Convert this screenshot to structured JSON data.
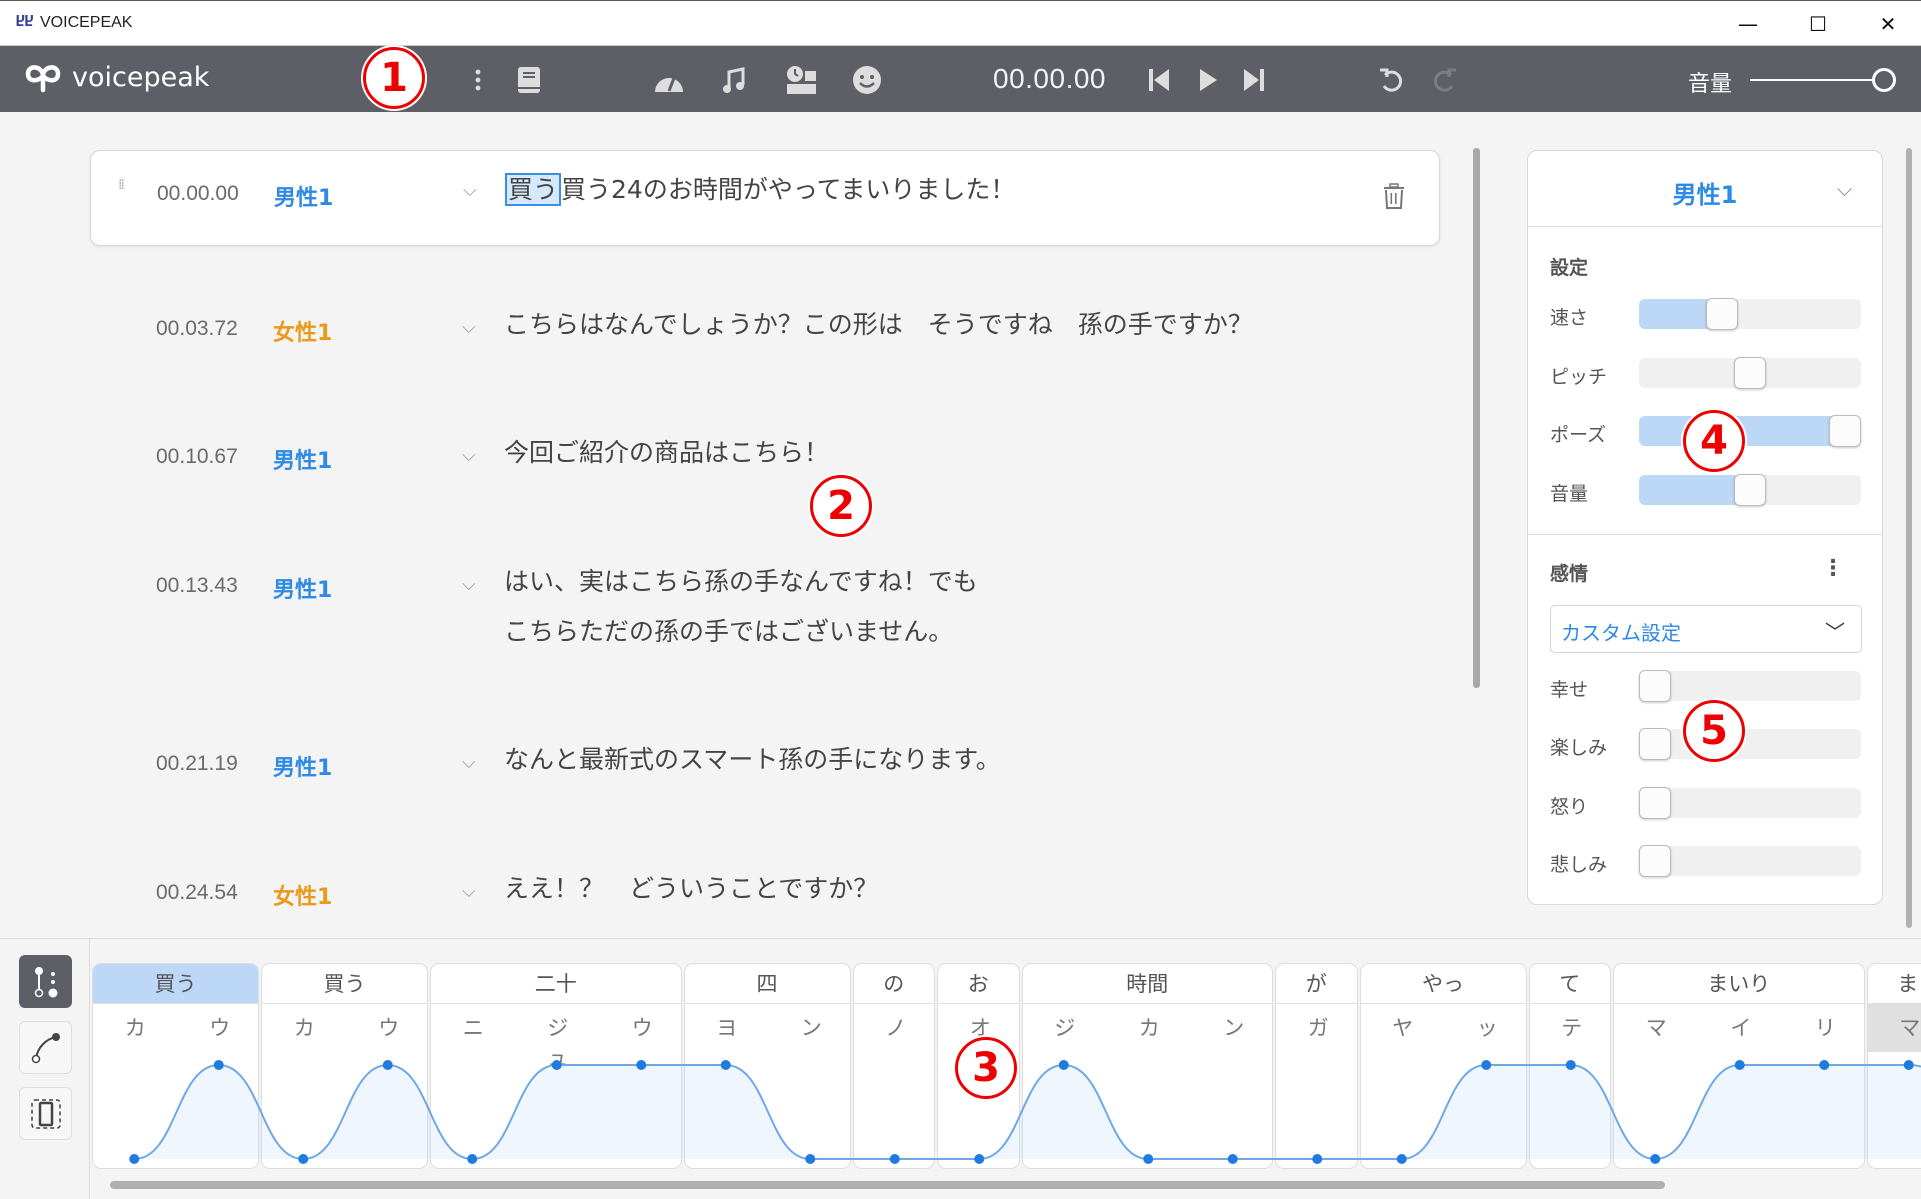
{
  "window": {
    "title": "VOICEPEAK",
    "controls": {
      "minimize": "—",
      "maximize": "☐",
      "close": "✕"
    }
  },
  "toolbar": {
    "logo_text": "voicepeak",
    "icons": [
      "menu-kebab",
      "dictionary-book",
      "speed-gauge",
      "music-note",
      "timing-clock",
      "emotion-face"
    ],
    "time": "00.00.00",
    "transport": [
      "skip-to-start",
      "play",
      "skip-to-end"
    ],
    "history": [
      "undo",
      "redo"
    ],
    "volume_label": "音量",
    "volume_level": 1.0
  },
  "script": {
    "rows": [
      {
        "time": "00.00.00",
        "speaker": "男性1",
        "gender": "male",
        "highlight": "買う",
        "text": "買う24のお時間がやってまいりました！",
        "selected": true
      },
      {
        "time": "00.03.72",
        "speaker": "女性1",
        "gender": "female",
        "highlight": "",
        "text": "こちらはなんでしょうか？この形は　そうですね　孫の手ですか？"
      },
      {
        "time": "00.10.67",
        "speaker": "男性1",
        "gender": "male",
        "highlight": "",
        "text": "今回ご紹介の商品はこちら！"
      },
      {
        "time": "00.13.43",
        "speaker": "男性1",
        "gender": "male",
        "highlight": "",
        "text": "はい、実はこちら孫の手なんですね！でも",
        "text2": "こちらただの孫の手ではございません。"
      },
      {
        "time": "00.21.19",
        "speaker": "男性1",
        "gender": "male",
        "highlight": "",
        "text": "なんと最新式のスマート孫の手になります。"
      },
      {
        "time": "00.24.54",
        "speaker": "女性1",
        "gender": "female",
        "highlight": "",
        "text": "ええ！？　どういうことですか？"
      }
    ]
  },
  "panel": {
    "speaker": "男性1",
    "settings_title": "設定",
    "settings": [
      {
        "label": "速さ",
        "value": 0.35,
        "filled": true
      },
      {
        "label": "ピッチ",
        "value": 0.5,
        "filled": false
      },
      {
        "label": "ポーズ",
        "value": 1.0,
        "filled": true
      },
      {
        "label": "音量",
        "value": 0.5,
        "filled": true
      }
    ],
    "emotion_title": "感情",
    "emotion_preset": "カスタム設定",
    "emotions": [
      {
        "label": "幸せ",
        "value": 0
      },
      {
        "label": "楽しみ",
        "value": 0
      },
      {
        "label": "怒り",
        "value": 0
      },
      {
        "label": "悲しみ",
        "value": 0
      }
    ]
  },
  "editor": {
    "tools": [
      "pitch-point-tool",
      "curve-tool",
      "range-select-tool"
    ],
    "phrases": [
      {
        "word": "買う",
        "moras": [
          "カ",
          "ウ"
        ],
        "selected": true
      },
      {
        "word": "買う",
        "moras": [
          "カ",
          "ウ"
        ]
      },
      {
        "word": "二十",
        "moras": [
          "ニ",
          "ジュ",
          "ウ"
        ]
      },
      {
        "word": "四",
        "moras": [
          "ヨ",
          "ン"
        ]
      },
      {
        "word": "の",
        "moras": [
          "ノ"
        ]
      },
      {
        "word": "お",
        "moras": [
          "オ"
        ]
      },
      {
        "word": "時間",
        "moras": [
          "ジ",
          "カ",
          "ン"
        ]
      },
      {
        "word": "が",
        "moras": [
          "ガ"
        ]
      },
      {
        "word": "やっ",
        "moras": [
          "ヤ",
          "ッ"
        ]
      },
      {
        "word": "て",
        "moras": [
          "テ"
        ]
      },
      {
        "word": "まいり",
        "moras": [
          "マ",
          "イ",
          "リ"
        ]
      },
      {
        "word": "ま",
        "moras": [
          "マ"
        ]
      }
    ],
    "pitch_levels": [
      0,
      1,
      0,
      1,
      0,
      1,
      1,
      1,
      0,
      0,
      0,
      1,
      0,
      0,
      0,
      0,
      1,
      1,
      0,
      1,
      1,
      1
    ]
  },
  "annotations": [
    "1",
    "2",
    "3",
    "4",
    "5"
  ]
}
